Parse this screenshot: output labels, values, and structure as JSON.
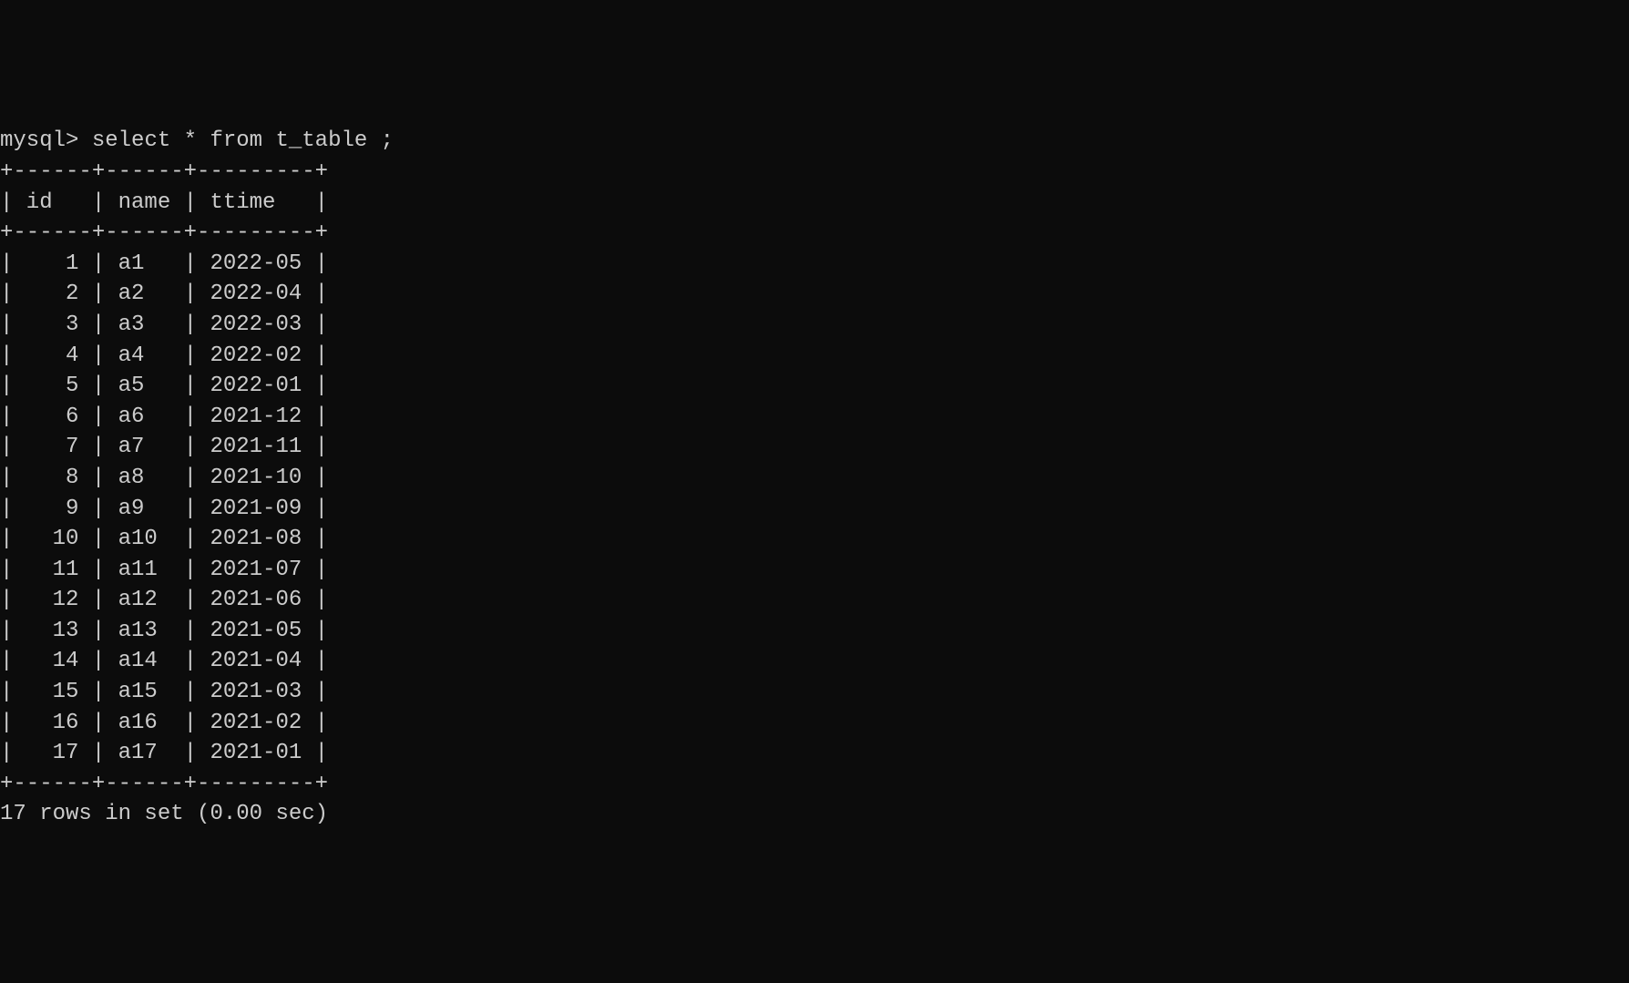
{
  "prompt": "mysql> ",
  "query": "select * from t_table ;",
  "columns": {
    "id": "id",
    "name": "name",
    "ttime": "ttime"
  },
  "col_widths": {
    "id": 6,
    "name": 6,
    "ttime": 9
  },
  "rows": [
    {
      "id": "1",
      "name": "a1",
      "ttime": "2022-05"
    },
    {
      "id": "2",
      "name": "a2",
      "ttime": "2022-04"
    },
    {
      "id": "3",
      "name": "a3",
      "ttime": "2022-03"
    },
    {
      "id": "4",
      "name": "a4",
      "ttime": "2022-02"
    },
    {
      "id": "5",
      "name": "a5",
      "ttime": "2022-01"
    },
    {
      "id": "6",
      "name": "a6",
      "ttime": "2021-12"
    },
    {
      "id": "7",
      "name": "a7",
      "ttime": "2021-11"
    },
    {
      "id": "8",
      "name": "a8",
      "ttime": "2021-10"
    },
    {
      "id": "9",
      "name": "a9",
      "ttime": "2021-09"
    },
    {
      "id": "10",
      "name": "a10",
      "ttime": "2021-08"
    },
    {
      "id": "11",
      "name": "a11",
      "ttime": "2021-07"
    },
    {
      "id": "12",
      "name": "a12",
      "ttime": "2021-06"
    },
    {
      "id": "13",
      "name": "a13",
      "ttime": "2021-05"
    },
    {
      "id": "14",
      "name": "a14",
      "ttime": "2021-04"
    },
    {
      "id": "15",
      "name": "a15",
      "ttime": "2021-03"
    },
    {
      "id": "16",
      "name": "a16",
      "ttime": "2021-02"
    },
    {
      "id": "17",
      "name": "a17",
      "ttime": "2021-01"
    }
  ],
  "footer": "17 rows in set (0.00 sec)"
}
